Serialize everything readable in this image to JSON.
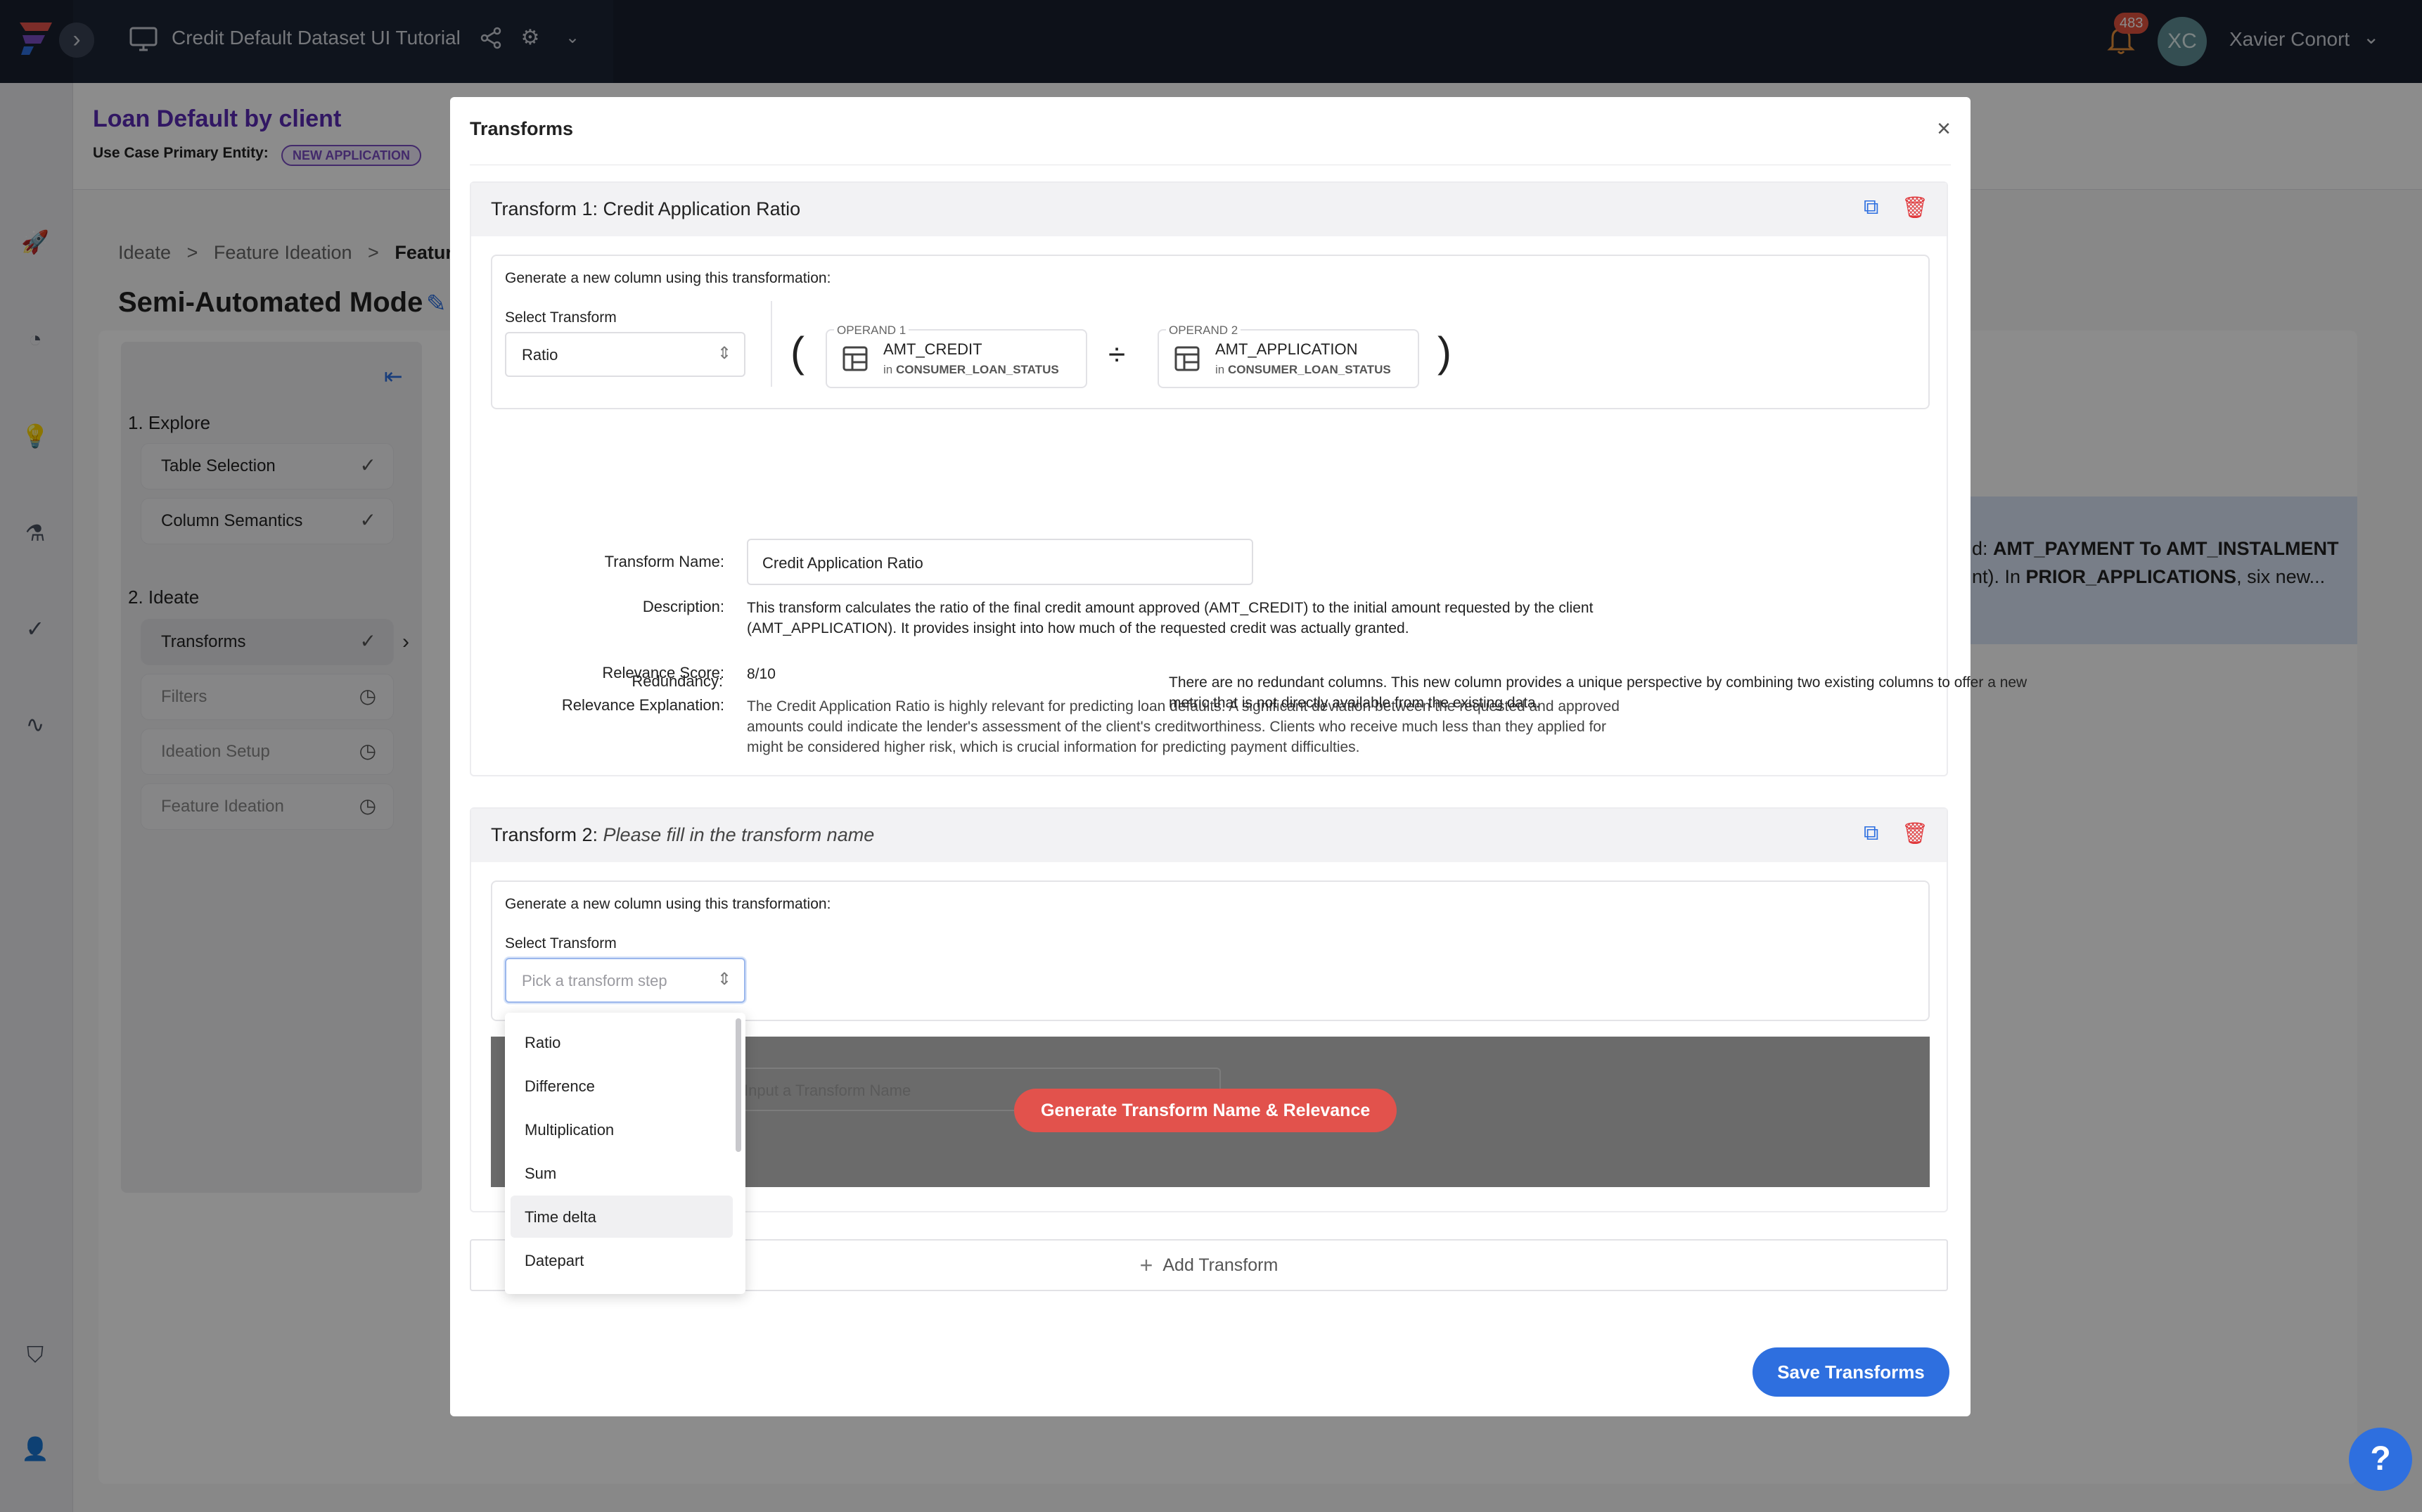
{
  "topbar": {
    "project_title": "Credit Default Dataset UI Tutorial",
    "notification_count": "483",
    "avatar_initials": "XC",
    "user_name": "Xavier Conort"
  },
  "use_case": {
    "title": "Loan Default by client",
    "primary_entity_label": "Use Case Primary Entity:",
    "primary_entity_badge": "NEW APPLICATION"
  },
  "breadcrumb": {
    "items": [
      "Ideate",
      "Feature Ideation",
      "Feature"
    ],
    "separator": ">"
  },
  "mode_title": "Semi-Automated Mode",
  "steps": {
    "explore_heading": "1. Explore",
    "explore_items": [
      {
        "label": "Table Selection",
        "status": "done"
      },
      {
        "label": "Column Semantics",
        "status": "done"
      }
    ],
    "ideate_heading": "2. Ideate",
    "ideate_items": [
      {
        "label": "Transforms",
        "status": "done"
      },
      {
        "label": "Filters",
        "status": "pending"
      },
      {
        "label": "Ideation Setup",
        "status": "pending"
      },
      {
        "label": "Feature Ideation",
        "status": "pending"
      }
    ]
  },
  "background_info": {
    "line1_prefix": "d: ",
    "line1_bold": "AMT_PAYMENT To AMT_INSTALMENT",
    "line2_prefix": "nt). In ",
    "line2_bold": "PRIOR_APPLICATIONS",
    "line2_suffix": ", six new..."
  },
  "modal": {
    "title": "Transforms",
    "transform1": {
      "header_prefix": "Transform 1: ",
      "header_name": "Credit Application Ratio",
      "generate_label": "Generate a new column using this transformation:",
      "select_label": "Select Transform",
      "select_value": "Ratio",
      "open_paren": "(",
      "close_paren": ")",
      "operator": "÷",
      "operand1": {
        "caption": "OPERAND 1",
        "name": "AMT_CREDIT",
        "in": "in",
        "table": "CONSUMER_LOAN_STATUS"
      },
      "operand2": {
        "caption": "OPERAND 2",
        "name": "AMT_APPLICATION",
        "in": "in",
        "table": "CONSUMER_LOAN_STATUS"
      },
      "fields": {
        "name_label": "Transform Name:",
        "name_value": "Credit Application Ratio",
        "description_label": "Description:",
        "description": "This transform calculates the ratio of the final credit amount approved (AMT_CREDIT) to the initial amount requested by the client (AMT_APPLICATION). It provides insight into how much of the requested credit was actually granted.",
        "relevance_score_label": "Relevance Score:",
        "relevance_score": "8/10",
        "relevance_explanation_label": "Relevance Explanation:",
        "relevance_explanation": "The Credit Application Ratio is highly relevant for predicting loan defaults. A significant deviation between the requested and approved amounts could indicate the lender's assessment of the client's creditworthiness. Clients who receive much less than they applied for might be considered higher risk, which is crucial information for predicting payment difficulties.",
        "redundancy_label": "Redundancy:",
        "redundancy": "There are no redundant columns. This new column provides a unique perspective by combining two existing columns to offer a new metric that is not directly available from the existing data."
      }
    },
    "transform2": {
      "header_prefix": "Transform 2: ",
      "header_name": "Please fill in the transform name",
      "generate_label": "Generate a new column using this transformation:",
      "select_label": "Select Transform",
      "select_placeholder": "Pick a transform step",
      "name_placeholder": "Input a Transform Name",
      "generate_button": "Generate Transform Name & Relevance"
    },
    "dropdown_options": [
      "Ratio",
      "Difference",
      "Multiplication",
      "Sum",
      "Time delta",
      "Datepart"
    ],
    "dropdown_hovered": "Time delta",
    "add_transform_label": "Add Transform",
    "save_button": "Save Transforms"
  },
  "help_button": "?",
  "colors": {
    "brand_purple": "#5a2bb5",
    "primary_blue": "#2e6fdf",
    "danger_red": "#e0383b",
    "generate_red": "#e2524c",
    "topbar_bg": "#18202e"
  },
  "icons": [
    "logo-icon",
    "monitor-icon",
    "share-icon",
    "gear-icon",
    "chevron-down-icon",
    "bell-icon",
    "rocket-icon",
    "brain-icon",
    "lightbulb-icon",
    "flask-icon",
    "check-icon",
    "activity-icon",
    "shield-icon",
    "user-search-icon",
    "copy-icon",
    "trash-icon",
    "table-icon",
    "close-icon",
    "plus-icon",
    "clock-pending-icon",
    "edit-icon",
    "collapse-left-icon"
  ]
}
